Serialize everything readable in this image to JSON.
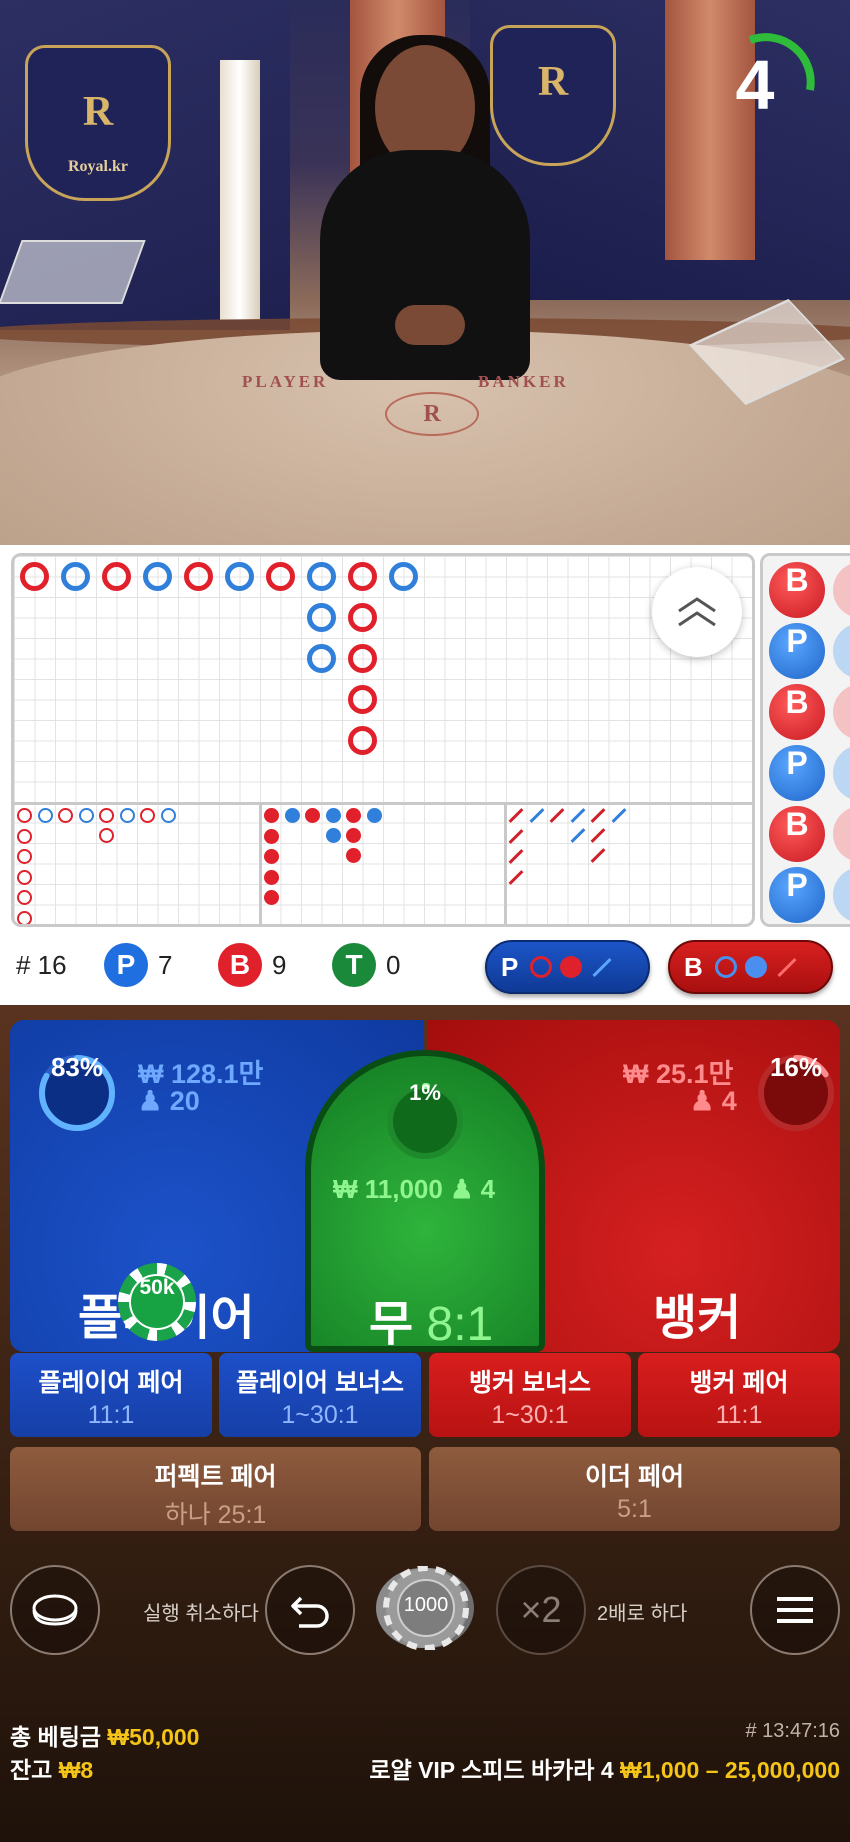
{
  "stream": {
    "countdown": "4",
    "countdown_fraction": 0.25,
    "brand_text": "Royal.kr",
    "table_label_player": "PLAYER",
    "table_label_banker": "BANKER"
  },
  "roadmap": {
    "round_number": "# 16",
    "player": {
      "letter": "P",
      "count": "7"
    },
    "banker": {
      "letter": "B",
      "count": "9"
    },
    "tie": {
      "letter": "T",
      "count": "0"
    },
    "player_predict": {
      "letter": "P"
    },
    "banker_predict": {
      "letter": "B"
    },
    "bead_column": [
      "B",
      "P",
      "B",
      "P",
      "B",
      "P"
    ]
  },
  "bets": {
    "player": {
      "label": "플레이어",
      "amount": "₩ 128.1만",
      "bettors": "20",
      "percent": "83%",
      "percent_value": 83
    },
    "banker": {
      "label": "뱅커",
      "amount": "₩ 25.1만",
      "bettors": "4",
      "percent": "16%",
      "percent_value": 16
    },
    "tie": {
      "label": "무",
      "odds": "8:1",
      "amount": "₩ 11,000",
      "bettors": "4",
      "percent": "1%",
      "percent_value": 1
    },
    "placed_chip": "50k",
    "side_bets": [
      {
        "name": "플레이어 페어",
        "odds": "11:1"
      },
      {
        "name": "플레이어 보너스",
        "odds": "1~30:1"
      },
      {
        "name": "뱅커 보너스",
        "odds": "1~30:1"
      },
      {
        "name": "뱅커 페어",
        "odds": "11:1"
      }
    ],
    "pair_bets": [
      {
        "name": "퍼펙트 페어",
        "odds": "하나 25:1"
      },
      {
        "name": "이더 페어",
        "odds": "5:1"
      }
    ]
  },
  "controls": {
    "undo_label": "실행 취소하다",
    "chip_value": "1000",
    "double_symbol": "×2",
    "double_label": "2배로 하다"
  },
  "footer": {
    "total_bet_label": "총 베팅금",
    "total_bet_value": "₩50,000",
    "balance_label": "잔고",
    "balance_value": "₩8",
    "round_id": "# 13:47:16",
    "table_name": "로얄 VIP 스피드 바카라 4",
    "limits": "₩1,000 – 25,000,000"
  },
  "colors": {
    "player": "#1f5bd0",
    "banker": "#d01a1a",
    "tie": "#1d9a2e",
    "highlight": "#f4c418"
  }
}
